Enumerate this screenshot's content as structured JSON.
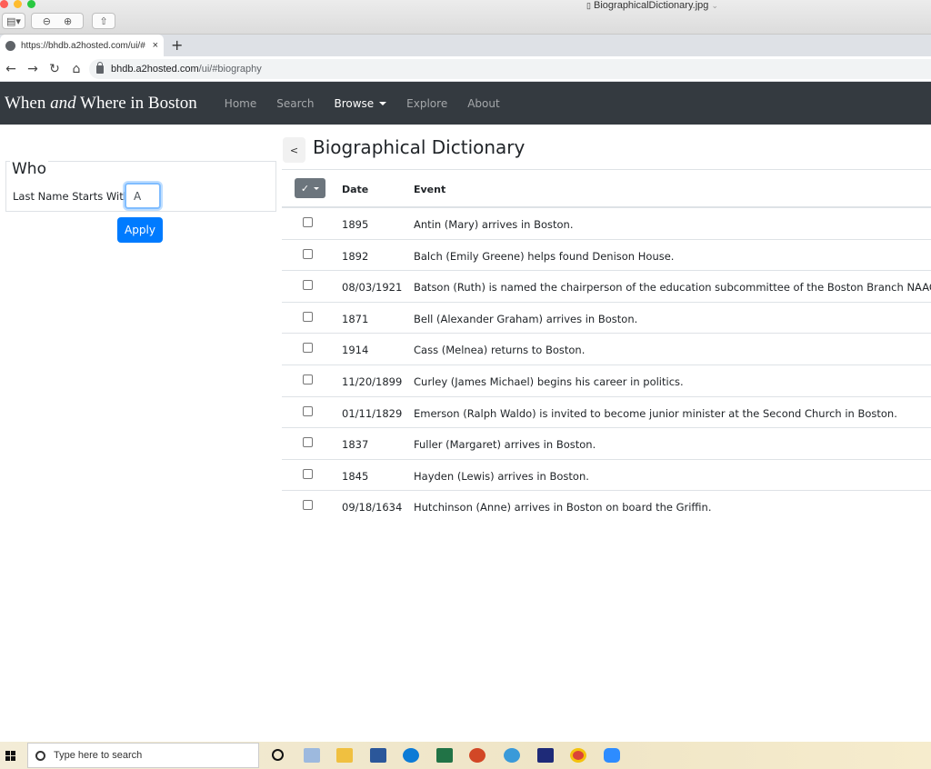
{
  "window": {
    "title": "BiographicalDictionary.jpg"
  },
  "browser": {
    "tab_title": "https://bhdb.a2hosted.com/ui/#",
    "tab_close": "×",
    "new_tab": "+",
    "url_host": "bhdb.a2hosted.com",
    "url_path": "/ui/#biography"
  },
  "navbar": {
    "brand_prefix": "When ",
    "brand_em": "and",
    "brand_suffix": " Where in Boston",
    "links": [
      "Home",
      "Search",
      "Browse",
      "Explore",
      "About"
    ],
    "active": "Browse"
  },
  "filter": {
    "legend": "Who",
    "label": "Last Name Starts With",
    "value": "A",
    "apply_label": "Apply"
  },
  "main": {
    "back_label": "<",
    "title": "Biographical Dictionary",
    "check_label": "✓",
    "columns": [
      "Date",
      "Event"
    ],
    "rows": [
      {
        "date": "1895",
        "event": "Antin (Mary) arrives in Boston."
      },
      {
        "date": "1892",
        "event": "Balch (Emily Greene) helps found Denison House."
      },
      {
        "date": "08/03/1921",
        "event": "Batson (Ruth) is named the chairperson of the education subcommittee of the Boston Branch NAACP."
      },
      {
        "date": "1871",
        "event": "Bell (Alexander Graham) arrives in Boston."
      },
      {
        "date": "1914",
        "event": "Cass (Melnea) returns to Boston."
      },
      {
        "date": "11/20/1899",
        "event": "Curley (James Michael) begins his career in politics."
      },
      {
        "date": "01/11/1829",
        "event": "Emerson (Ralph Waldo) is invited to become junior minister at the Second Church in Boston."
      },
      {
        "date": "1837",
        "event": "Fuller (Margaret) arrives in Boston."
      },
      {
        "date": "1845",
        "event": "Hayden (Lewis) arrives in Boston."
      },
      {
        "date": "09/18/1634",
        "event": "Hutchinson (Anne) arrives in Boston on board the Griffin."
      }
    ]
  },
  "taskbar": {
    "search_placeholder": "Type here to search",
    "icons": [
      "windows-start-icon",
      "cortana-icon",
      "dropbox-icon",
      "file-explorer-icon",
      "word-icon",
      "edge-icon",
      "excel-icon",
      "powerpoint-icon",
      "internet-explorer-icon",
      "app-icon",
      "chrome-icon",
      "zoom-icon"
    ],
    "colors": {
      "word": "#2b579a",
      "edge": "#0c7bd6",
      "excel": "#217346",
      "powerpoint": "#d24726",
      "chrome": "#db4437",
      "zoom": "#2d8cff",
      "dropbox": "#0061fe"
    }
  }
}
